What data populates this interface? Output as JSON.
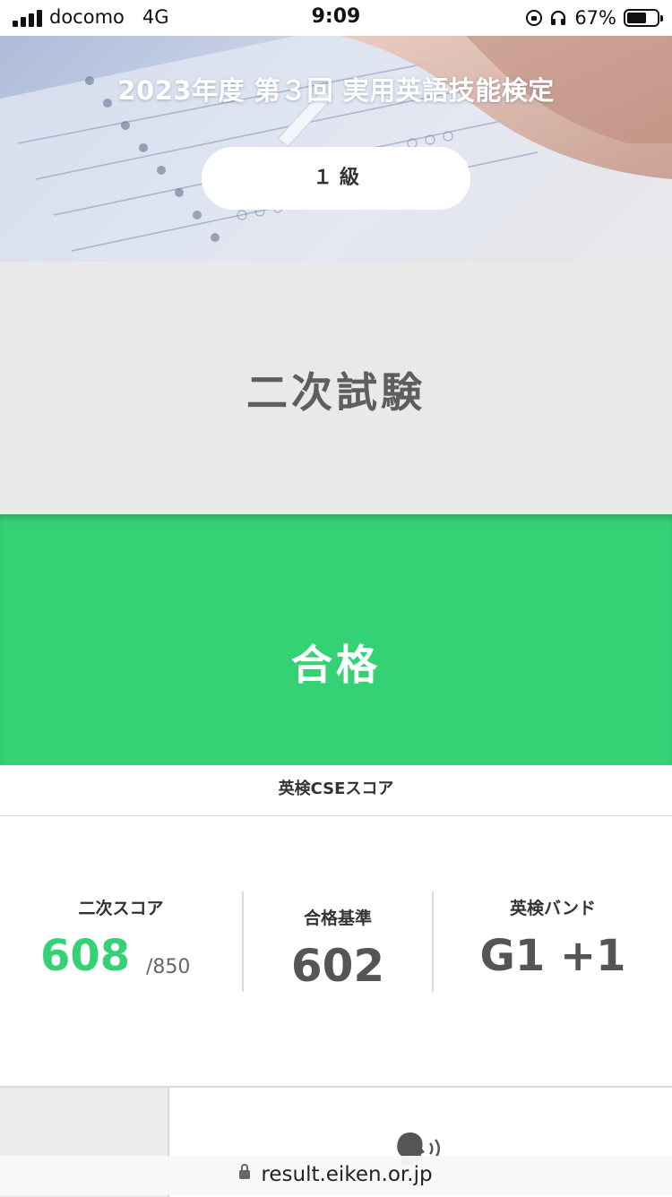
{
  "status_bar": {
    "carrier": "docomo",
    "network": "4G",
    "time": "9:09",
    "battery_percent": "67%",
    "battery_level": 0.67
  },
  "hero": {
    "title": "2023年度 第３回 実用英語技能検定",
    "grade": "１ 級"
  },
  "exam": {
    "type": "二次試験"
  },
  "result": {
    "label": "合格",
    "color": "#34d175"
  },
  "cse": {
    "heading": "英検CSEスコア",
    "secondary_score": {
      "label": "二次スコア",
      "value": "608",
      "max": "/850"
    },
    "passing_standard": {
      "label": "合格基準",
      "value": "602"
    },
    "eiken_band": {
      "label": "英検バンド",
      "value": "G1 +1"
    }
  },
  "browser": {
    "url": "result.eiken.or.jp"
  },
  "icons": [
    "signal-icon",
    "orientation-lock-icon",
    "headphones-icon",
    "battery-icon",
    "speaking-icon",
    "lock-icon"
  ]
}
